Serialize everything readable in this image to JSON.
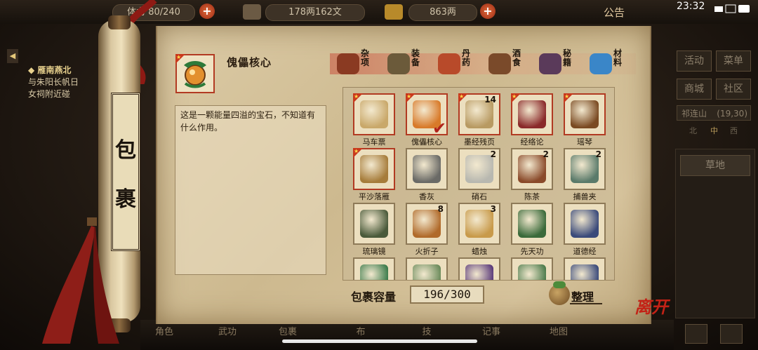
{
  "topbar": {
    "stat_partial": "体力 80/240",
    "money_silver": "178两162文",
    "money_gold": "863两",
    "notice": "公告",
    "clock": "23:32"
  },
  "left": {
    "quest_title": "◆ 雁南燕北",
    "quest_line1": "与朱阳长帆日",
    "quest_line2": "女祠附近碰"
  },
  "right_menu": {
    "activity": "活动",
    "menu": "菜单",
    "shop": "商城",
    "community": "社区",
    "location": "祁连山",
    "coords": "(19,30)",
    "directions": [
      "北",
      "中",
      "西"
    ],
    "terrain": "草地"
  },
  "bottom_nav": [
    "角色",
    "武功",
    "包裹",
    "布",
    "技",
    "记事",
    "地图"
  ],
  "scroll_label": [
    "包",
    "裹"
  ],
  "selected": {
    "name": "傀儡核心",
    "description": "这是一颗能量四溢的宝石，不知道有什么作用。"
  },
  "category_tabs": [
    {
      "label": "杂项",
      "color": "#8a3a22"
    },
    {
      "label": "装备",
      "color": "#6b5a3a"
    },
    {
      "label": "丹药",
      "color": "#b84a2a"
    },
    {
      "label": "酒食",
      "color": "#7a4a2a"
    },
    {
      "label": "秘籍",
      "color": "#5a3a5a"
    },
    {
      "label": "材料",
      "color": "#3a86c8"
    }
  ],
  "items": [
    {
      "name": "马车票",
      "count": "",
      "red": true,
      "art": "#c9a86a"
    },
    {
      "name": "傀儡核心",
      "count": "",
      "red": true,
      "art": "#d87a2a",
      "checked": true
    },
    {
      "name": "墨经残页",
      "count": "14",
      "red": true,
      "art": "#b89a62"
    },
    {
      "name": "经络论",
      "count": "",
      "red": true,
      "art": "#8a2a2a"
    },
    {
      "name": "瑶琴",
      "count": "",
      "red": true,
      "art": "#7a4a22"
    },
    {
      "name": "平沙落雁",
      "count": "",
      "red": true,
      "art": "#a67c3a"
    },
    {
      "name": "香灰",
      "count": "",
      "red": false,
      "art": "#6a6a66"
    },
    {
      "name": "硝石",
      "count": "2",
      "red": false,
      "art": "#b8b8b0"
    },
    {
      "name": "陈茶",
      "count": "2",
      "red": false,
      "art": "#8a4a2a"
    },
    {
      "name": "捕兽夹",
      "count": "2",
      "red": false,
      "art": "#5a7a6a"
    },
    {
      "name": "琉璃镜",
      "count": "",
      "red": false,
      "art": "#4a5a3a"
    },
    {
      "name": "火折子",
      "count": "8",
      "red": false,
      "art": "#b06a2a"
    },
    {
      "name": "蜡烛",
      "count": "3",
      "red": false,
      "art": "#c89a4a"
    },
    {
      "name": "先天功",
      "count": "",
      "red": false,
      "art": "#3a6a3a"
    },
    {
      "name": "道德经",
      "count": "",
      "red": false,
      "art": "#3a4a7a"
    },
    {
      "name": "",
      "count": "",
      "red": false,
      "art": "#3a7a4a"
    },
    {
      "name": "",
      "count": "",
      "red": false,
      "art": "#6a8a5a"
    },
    {
      "name": "",
      "count": "",
      "red": false,
      "art": "#5a3a7a"
    },
    {
      "name": "",
      "count": "",
      "red": false,
      "art": "#4a7a4a"
    },
    {
      "name": "",
      "count": "",
      "red": false,
      "art": "#3a4a7a"
    }
  ],
  "footer": {
    "capacity_label": "包裹容量",
    "capacity_value": "196/300",
    "sort_label": "整理",
    "leave_label": "离开"
  }
}
